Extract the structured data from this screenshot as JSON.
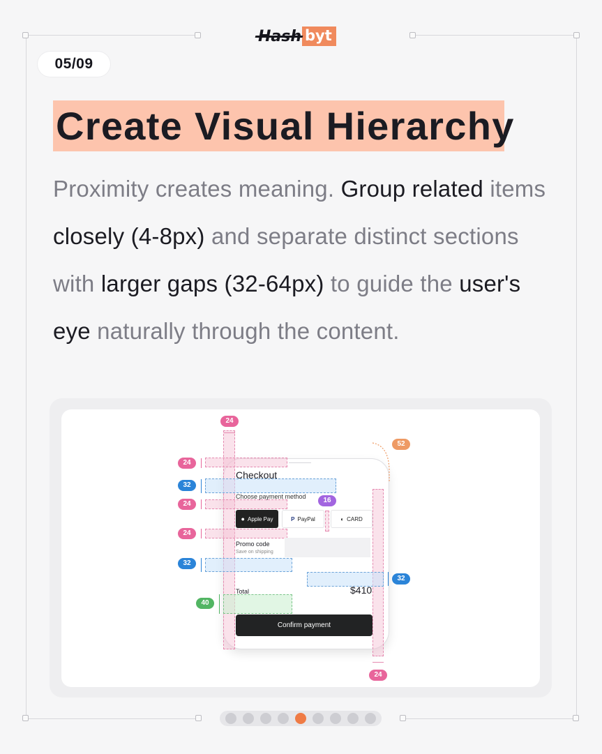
{
  "brand": {
    "logo_left": "Hash",
    "logo_right": "byt"
  },
  "slide": {
    "counter": "05/09",
    "active_index": 4,
    "total": 9
  },
  "headline": "Create Visual Hierarchy",
  "body": {
    "s1": "Proximity creates meaning. ",
    "s2": "Group related",
    "s3": " items ",
    "s4": "closely (4-8px)",
    "s5": " and separate distinct sections with ",
    "s6": "larger gaps (32-64px)",
    "s7": " to guide the ",
    "s8": "user's eye",
    "s9": " naturally through the content."
  },
  "mockup": {
    "title": "Checkout",
    "payment_label": "Choose payment method",
    "apple_pay": "Apple Pay",
    "paypal": "PayPal",
    "card": "CARD",
    "promo_label": "Promo code",
    "promo_hint": "Save on shipping",
    "total_label": "Total",
    "total_value": "$410",
    "confirm_label": "Confirm payment"
  },
  "spacing_badges": {
    "top": "24",
    "row1": "24",
    "row2": "32",
    "row3": "24",
    "row4": "24",
    "row5": "32",
    "green": "40",
    "purple": "16",
    "orange": "52",
    "right_blue": "32",
    "bottom": "24"
  },
  "colors": {
    "accent": "#f08a5d",
    "highlight": "#fdc4ad",
    "pink": "#e8659b",
    "blue": "#2b84d8",
    "green": "#52b563",
    "purple": "#a265e0",
    "orange": "#ee9a64"
  }
}
